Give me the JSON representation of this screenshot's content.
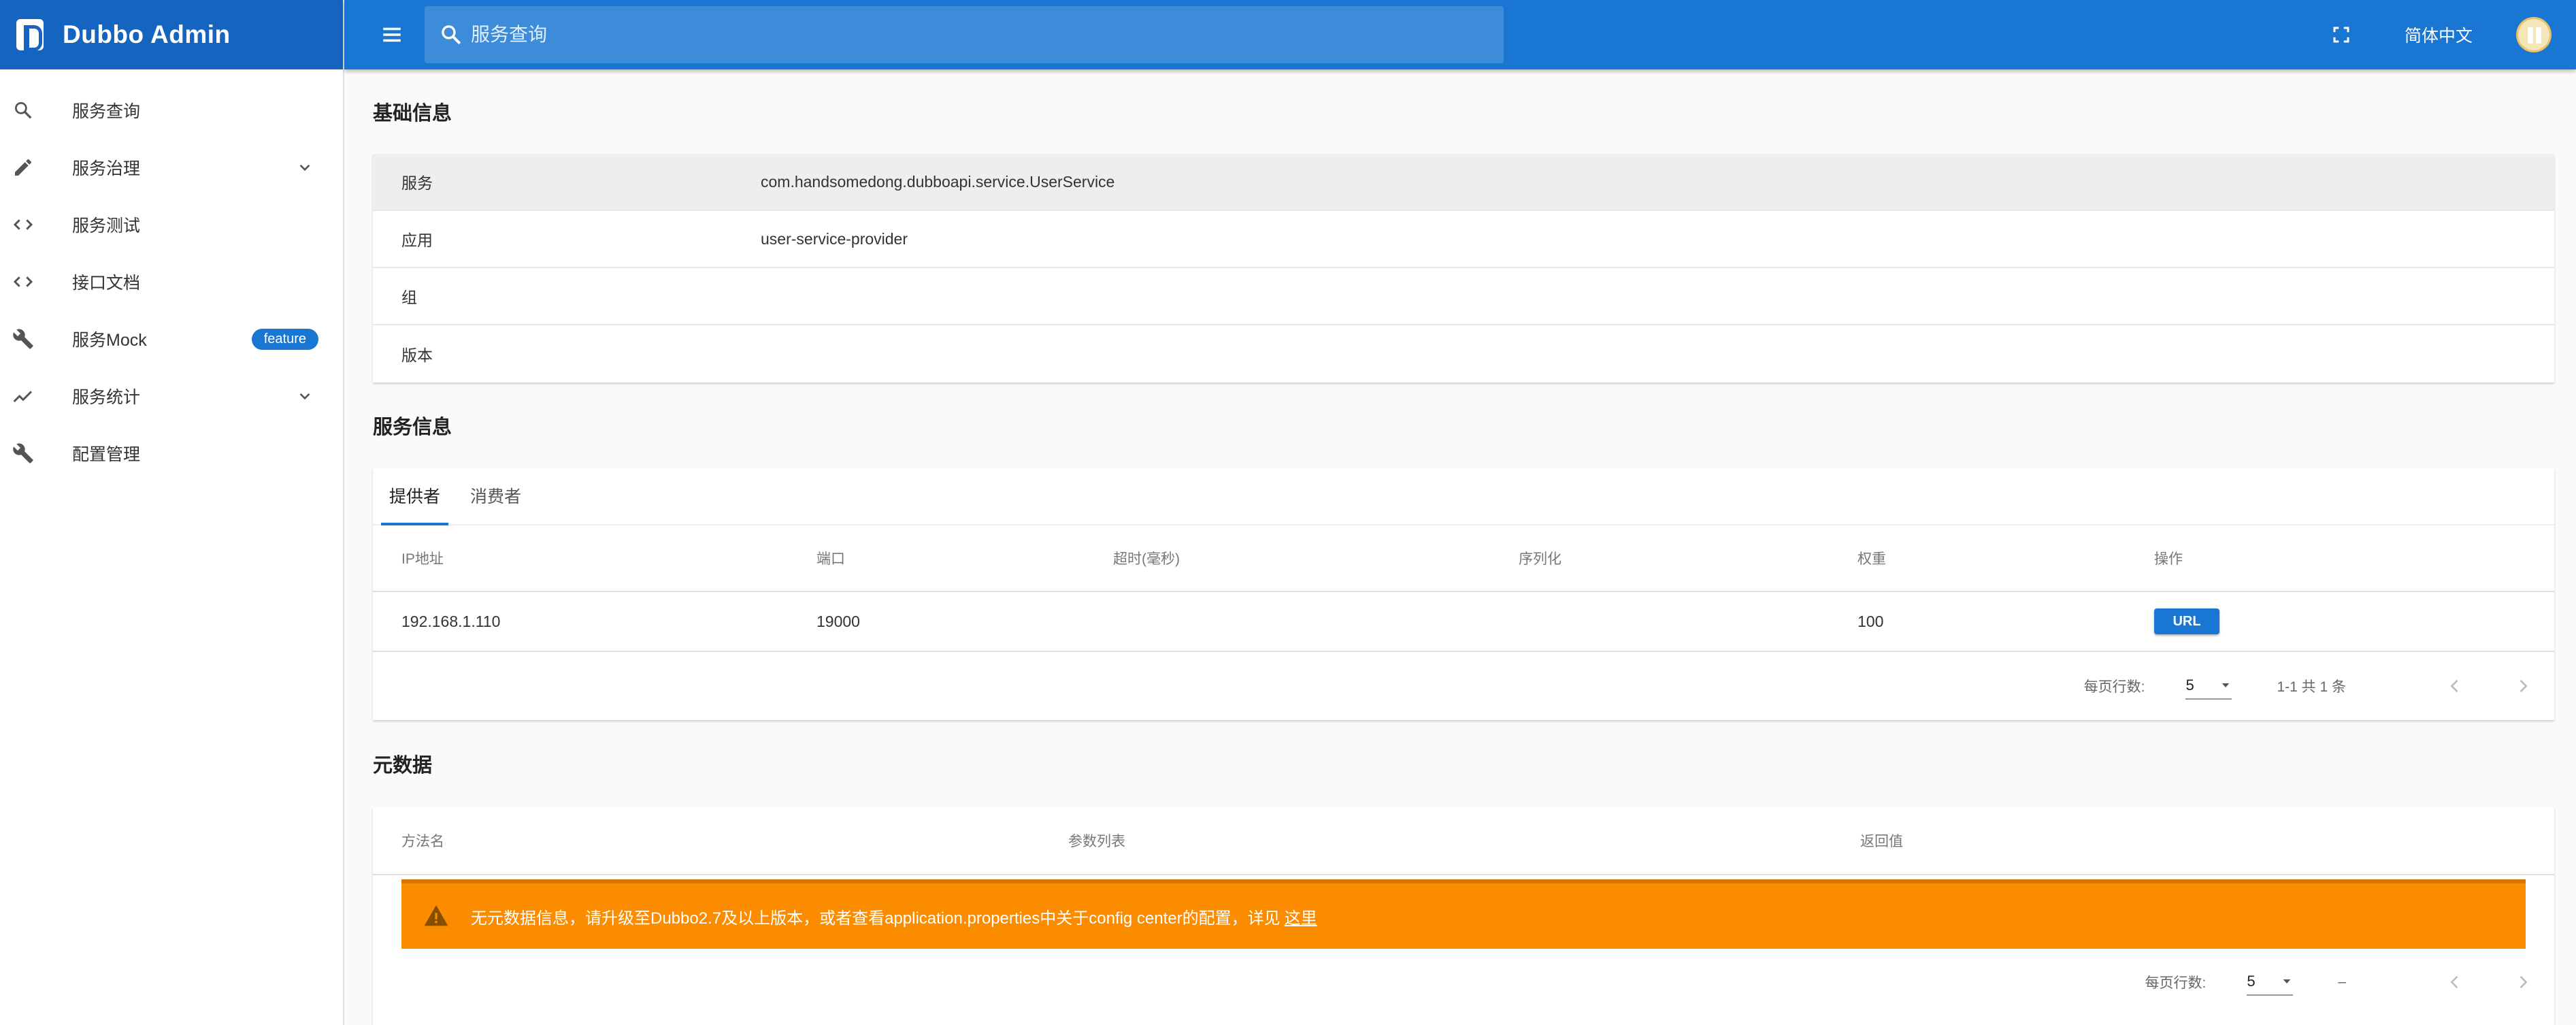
{
  "app": {
    "title": "Dubbo Admin"
  },
  "sidebar": {
    "items": [
      {
        "label": "服务查询",
        "icon": "search-icon"
      },
      {
        "label": "服务治理",
        "icon": "pencil-icon",
        "expandable": true
      },
      {
        "label": "服务测试",
        "icon": "code-icon"
      },
      {
        "label": "接口文档",
        "icon": "code-icon"
      },
      {
        "label": "服务Mock",
        "icon": "wrench-icon",
        "badge": "feature"
      },
      {
        "label": "服务统计",
        "icon": "trending-icon",
        "expandable": true
      },
      {
        "label": "配置管理",
        "icon": "wrench-icon"
      }
    ]
  },
  "header": {
    "search_placeholder": "服务查询",
    "language": "简体中文"
  },
  "basic_info": {
    "title": "基础信息",
    "rows": [
      {
        "key": "服务",
        "value": "com.handsomedong.dubboapi.service.UserService"
      },
      {
        "key": "应用",
        "value": "user-service-provider"
      },
      {
        "key": "组",
        "value": ""
      },
      {
        "key": "版本",
        "value": ""
      }
    ]
  },
  "service_info": {
    "title": "服务信息",
    "tabs": [
      "提供者",
      "消费者"
    ],
    "active_tab": "提供者",
    "columns": [
      "IP地址",
      "端口",
      "超时(毫秒)",
      "序列化",
      "权重",
      "操作"
    ],
    "rows": [
      {
        "ip": "192.168.1.110",
        "port": "19000",
        "timeout": "",
        "serialization": "",
        "weight": "100",
        "action": "URL"
      }
    ],
    "pager": {
      "label": "每页行数:",
      "per_page": "5",
      "info": "1-1 共 1 条"
    }
  },
  "metadata": {
    "title": "元数据",
    "columns": [
      "方法名",
      "参数列表",
      "返回值"
    ],
    "alert_text": "无元数据信息，请升级至Dubbo2.7及以上版本，或者查看application.properties中关于config center的配置，详见",
    "alert_link": "这里",
    "pager": {
      "label": "每页行数:",
      "per_page": "5",
      "info": "–"
    }
  },
  "colors": {
    "primary": "#1976d2",
    "brand": "#1565c0",
    "warning": "#fb8c00"
  }
}
